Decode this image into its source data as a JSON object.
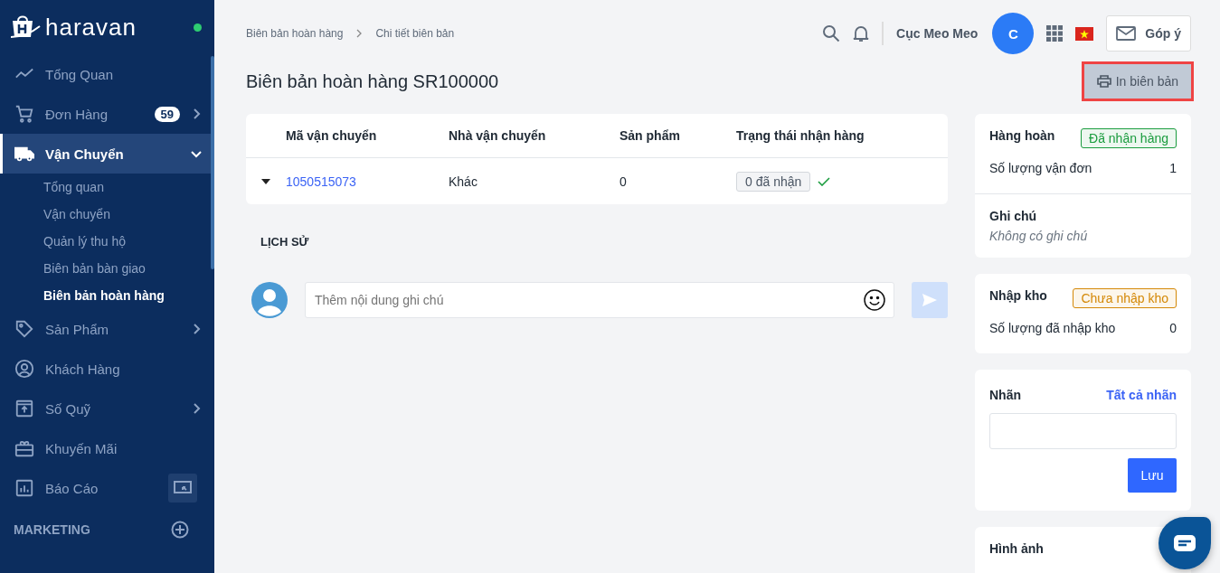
{
  "sidebar": {
    "brand": "haravan",
    "online": true,
    "items": [
      {
        "label": "Tổng Quan",
        "selected": false
      },
      {
        "label": "Đơn Hàng",
        "badge": "59",
        "selected": false,
        "expanded": false
      },
      {
        "label": "Vận Chuyển",
        "selected": true,
        "expanded": true,
        "children": [
          {
            "label": "Tổng quan",
            "selected": false
          },
          {
            "label": "Vận chuyển",
            "selected": false
          },
          {
            "label": "Quản lý thu hộ",
            "selected": false
          },
          {
            "label": "Biên bản bàn giao",
            "selected": false
          },
          {
            "label": "Biên bản hoàn hàng",
            "selected": true
          }
        ]
      },
      {
        "label": "Sản Phẩm",
        "selected": false,
        "expanded": false
      },
      {
        "label": "Khách Hàng",
        "selected": false
      },
      {
        "label": "Số Quỹ",
        "selected": false,
        "expanded": false
      },
      {
        "label": "Khuyến Mãi",
        "selected": false
      },
      {
        "label": "Báo Cáo",
        "selected": false,
        "side_button": true
      }
    ],
    "section": "MARKETING"
  },
  "breadcrumb": [
    "Biên bản hoàn hàng",
    "Chi tiết biên bản"
  ],
  "header": {
    "user": "Cục Meo Meo",
    "avatar": "C",
    "feedback": "Góp ý"
  },
  "title": "Biên bản hoàn hàng SR100000",
  "print_button": {
    "label": "In biên bản",
    "highlighted": true
  },
  "table": {
    "columns": [
      "Mã vận chuyển",
      "Nhà vận chuyển",
      "Sản phẩm",
      "Trạng thái nhận hàng"
    ],
    "rows": [
      {
        "expanded": false,
        "code": "1050515073",
        "carrier": "Khác",
        "products": "0",
        "status": "0 đã nhận",
        "received": true
      }
    ]
  },
  "history": {
    "title": "LỊCH SỬ",
    "placeholder": "Thêm nội dung ghi chú"
  },
  "return_card": {
    "title": "Hàng hoàn",
    "badge": {
      "text": "Đã nhận hàng",
      "kind": "success"
    },
    "rows": [
      {
        "label": "Số lượng vận đơn",
        "value": "1"
      }
    ],
    "note_title": "Ghi chú",
    "note": "Không có ghi chú"
  },
  "stock_card": {
    "title": "Nhập kho",
    "badge": {
      "text": "Chưa nhập kho",
      "kind": "warning"
    },
    "rows": [
      {
        "label": "Số lượng đã nhập kho",
        "value": "0"
      }
    ]
  },
  "tags_card": {
    "title": "Nhãn",
    "link": "Tất cả nhãn",
    "save": "Lưu"
  },
  "images_card": {
    "title": "Hình ảnh"
  }
}
